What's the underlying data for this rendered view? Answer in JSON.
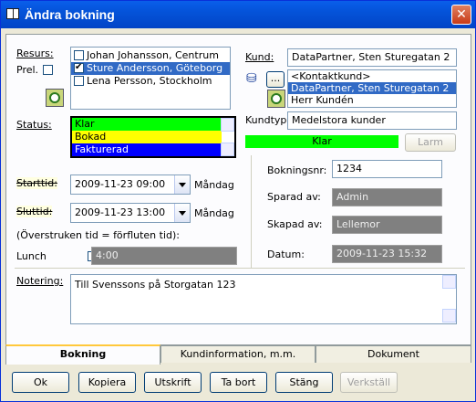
{
  "window": {
    "title": "Ändra bokning"
  },
  "labels": {
    "resurs": "Resurs:",
    "prel": "Prel.",
    "kund": "Kund:",
    "status": "Status:",
    "kundtyp": "Kundtyp:",
    "starttid": "Starttid:",
    "sluttid": "Sluttid:",
    "overstruken": "(Överstruken tid = förfluten tid):",
    "lunch": "Lunch",
    "bokningsnr": "Bokningsnr:",
    "sparad_av": "Sparad av:",
    "skapad_av": "Skapad av:",
    "datum": "Datum:",
    "notering": "Notering:"
  },
  "resources": [
    {
      "name": "Johan Johansson, Centrum",
      "checked": false,
      "selected": false
    },
    {
      "name": "Sture Andersson, Göteborg",
      "checked": true,
      "selected": true
    },
    {
      "name": "Lena Persson, Stockholm",
      "checked": false,
      "selected": false
    }
  ],
  "customer": {
    "value": "DataPartner, Sten Sturegatan 2",
    "contacts": [
      {
        "name": "<Kontaktkund>",
        "selected": false
      },
      {
        "name": "DataPartner, Sten Sturegatan 2",
        "selected": true
      },
      {
        "name": "Herr Kundén",
        "selected": false
      }
    ],
    "kundtyp": "Medelstora kunder",
    "status_bar": "Klar",
    "larm": "Larm",
    "browse": "..."
  },
  "status_options": [
    {
      "name": "Klar",
      "color": "#00ff00"
    },
    {
      "name": "Bokad",
      "color": "#ffff00"
    },
    {
      "name": "Fakturerad",
      "color": "#0000ff"
    }
  ],
  "times": {
    "start": "2009-11-23 09:00",
    "start_day": "Måndag",
    "end": "2009-11-23 13:00",
    "end_day": "Måndag",
    "lunch": "4:00"
  },
  "info": {
    "bokningsnr": "1234",
    "sparad_av": "Admin",
    "skapad_av": "Lellemor",
    "datum": "2009-11-23 15:32"
  },
  "notering": "Till Svenssons på Storgatan 123",
  "tabs": [
    {
      "label": "Bokning",
      "active": true
    },
    {
      "label": "Kundinformation, m.m.",
      "active": false
    },
    {
      "label": "Dokument",
      "active": false
    }
  ],
  "buttons": {
    "ok": "Ok",
    "kopiera": "Kopiera",
    "utskrift": "Utskrift",
    "ta_bort": "Ta bort",
    "stang": "Stäng",
    "verkstall": "Verkställ"
  },
  "icons": {
    "title": "book-icon",
    "close": "close-icon",
    "clock": "clock-icon",
    "binoculars": "binoculars-icon"
  }
}
